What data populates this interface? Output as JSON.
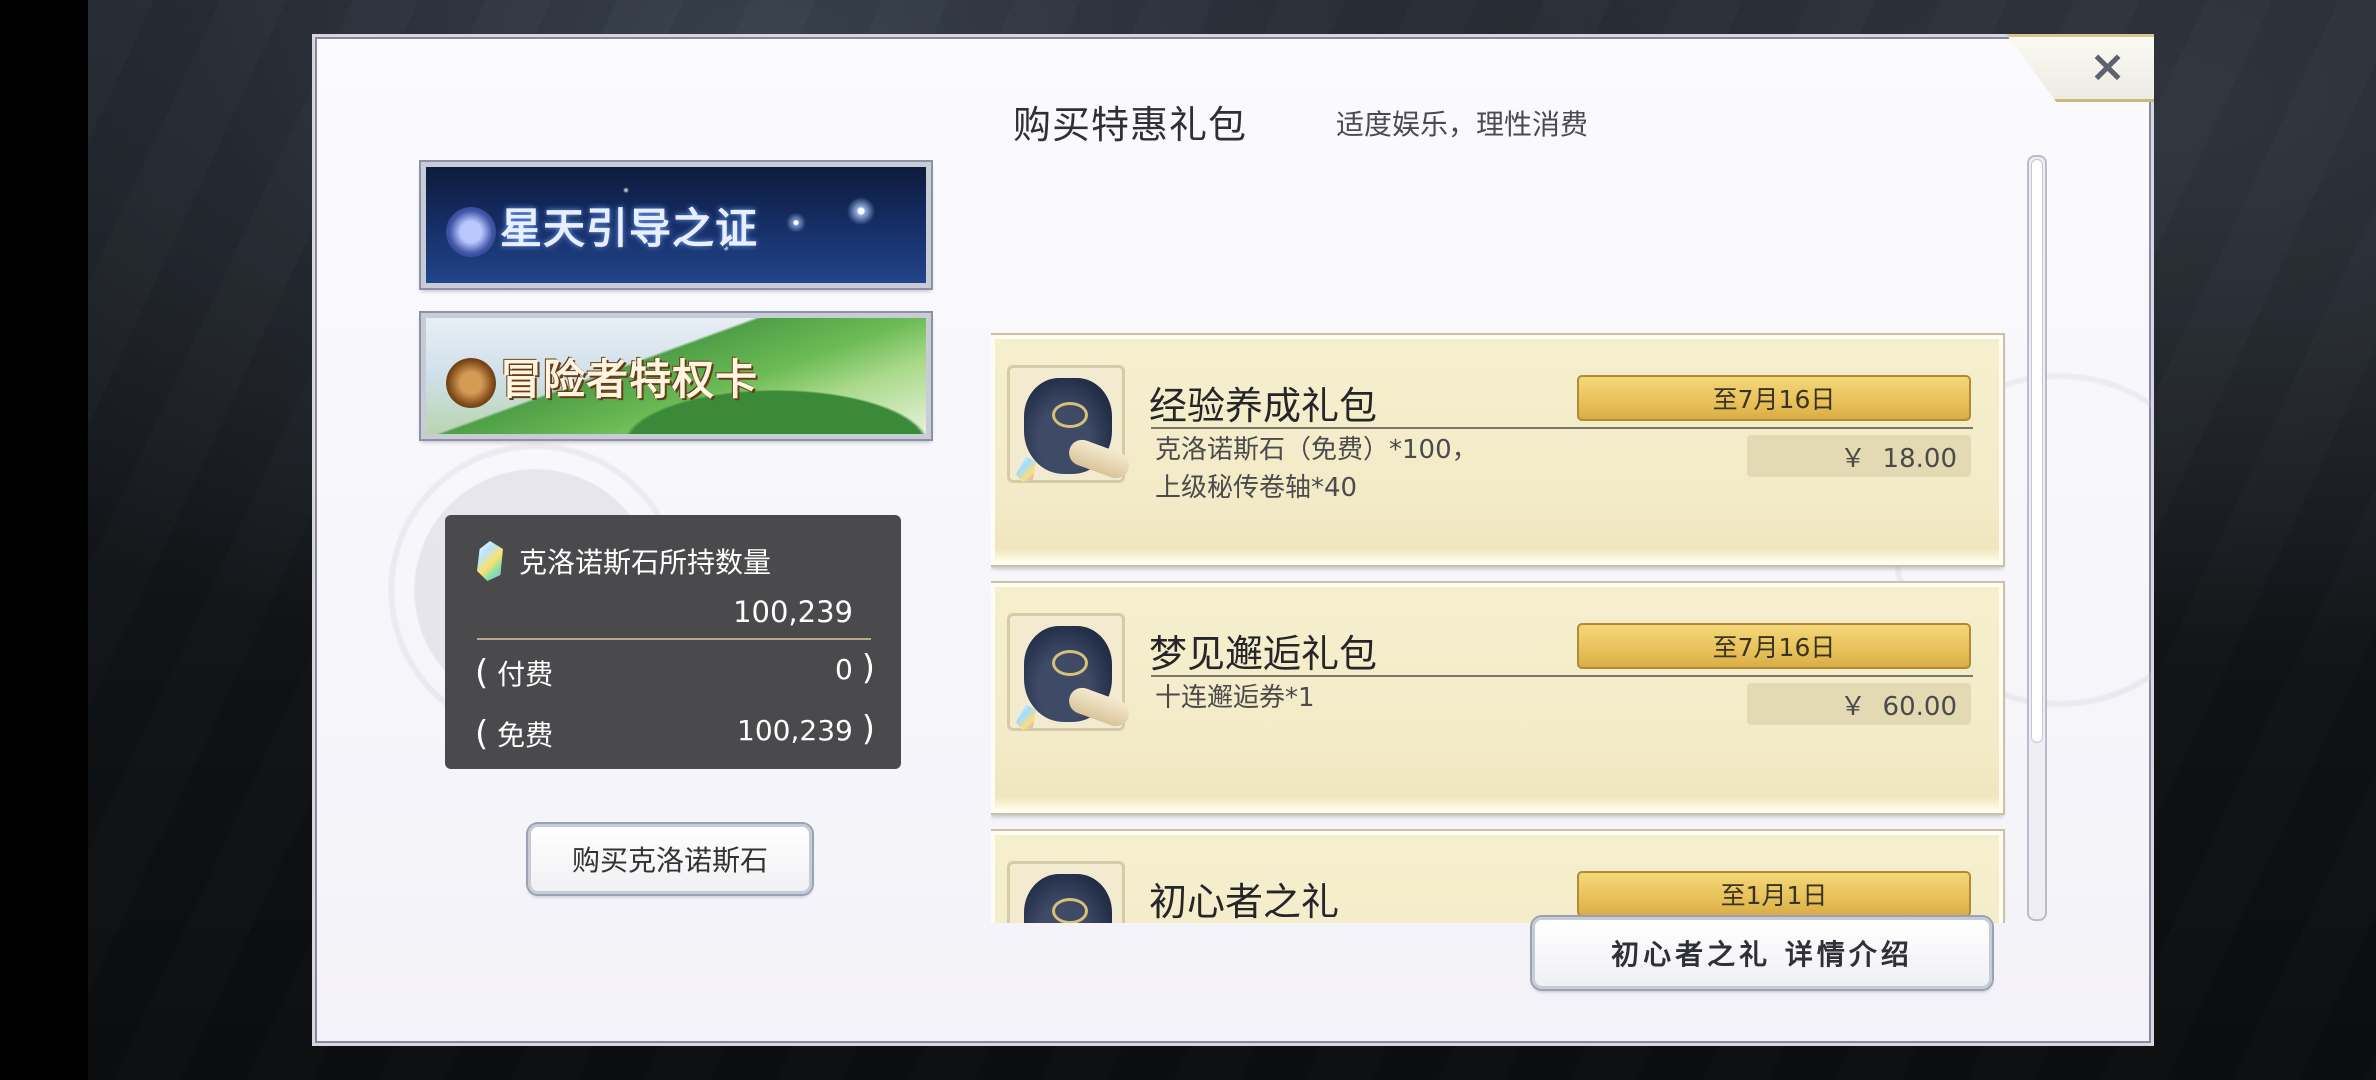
{
  "dialog": {
    "title": "购买特惠礼包",
    "subtitle": "适度娱乐，理性消费",
    "close_icon": "×"
  },
  "banners": [
    {
      "label": "星天引导之证",
      "icon": "star-emblem-icon"
    },
    {
      "label": "冒险者特权卡",
      "icon": "adventurer-emblem-icon"
    }
  ],
  "currency": {
    "title": "克洛诺斯石所持数量",
    "total": "100,239",
    "paid_label": "付费",
    "paid_value": "0",
    "free_label": "免费",
    "free_value": "100,239",
    "paren_open": "(",
    "paren_close": ")"
  },
  "buy_stone_button": "购买克洛诺斯石",
  "packs": [
    {
      "name": "经验养成礼包",
      "desc_lines": [
        "克洛诺斯石（免费）*100，",
        "上级秘传卷轴*40"
      ],
      "until": "至7月16日",
      "price": "￥  18.00"
    },
    {
      "name": "梦见邂逅礼包",
      "desc_lines": [
        "十连邂逅券*1",
        ""
      ],
      "until": "至7月16日",
      "price": "￥  60.00"
    },
    {
      "name": "初心者之礼",
      "desc_lines": [
        "",
        ""
      ],
      "until": "至1月1日",
      "price": ""
    }
  ],
  "detail_button": "初心者之礼 详情介绍",
  "colors": {
    "pack_bg": "#f6efcd",
    "date_badge": "#e8c15a",
    "currency_panel": "#4a4a4d"
  },
  "scroll_position": 0
}
